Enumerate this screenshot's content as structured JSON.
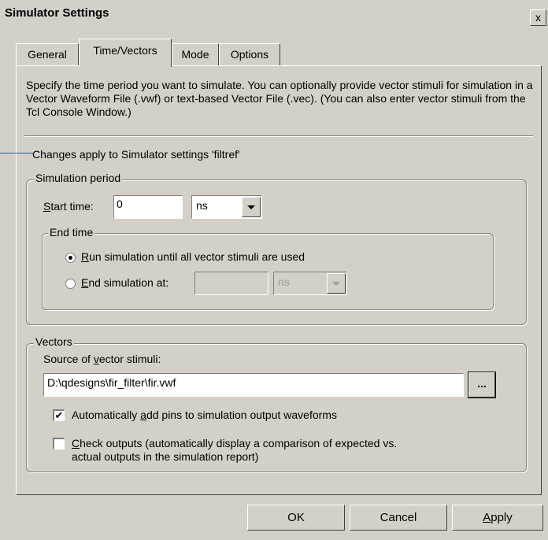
{
  "window": {
    "title": "Simulator Settings",
    "close_glyph": "x"
  },
  "tabs": [
    {
      "label": "General"
    },
    {
      "label": "Time/Vectors",
      "selected": true
    },
    {
      "label": "Mode"
    },
    {
      "label": "Options"
    }
  ],
  "description": "Specify the time period you want to simulate.  You can optionally provide vector stimuli for simulation in a Vector Waveform File (.vwf) or text-based Vector File (.vec).  (You can also enter vector stimuli from the Tcl Console Window.)",
  "changes_note": "Changes apply to Simulator settings 'filtref'",
  "simulation_period": {
    "legend": "Simulation period",
    "start_time_label_prefix": "S",
    "start_time_label_rest": "tart time:",
    "start_time_value": "0",
    "start_unit": "ns",
    "end_time": {
      "legend": "End time",
      "run_until_prefix": "R",
      "run_until_rest": "un simulation until all vector stimuli are used",
      "run_until_selected": true,
      "end_at_prefix": "E",
      "end_at_rest": "nd simulation at:",
      "end_at_value": "",
      "end_unit": "ns"
    }
  },
  "vectors": {
    "legend": "Vectors",
    "source_label_pre": "Source of ",
    "source_label_u": "v",
    "source_label_post": "ector stimuli:",
    "source_value": "D:\\qdesigns\\fir_filter\\fir.vwf",
    "browse_label": "...",
    "auto_add_pre": "Automatically ",
    "auto_add_u": "a",
    "auto_add_post": "dd pins to simulation output waveforms",
    "auto_add_checked": true,
    "check_outputs_u": "C",
    "check_outputs_line1": "heck outputs (automatically display a comparison of expected vs.",
    "check_outputs_line2": "actual outputs in the simulation report)",
    "check_outputs_checked": false
  },
  "buttons": {
    "ok": "OK",
    "cancel": "Cancel",
    "apply_u": "A",
    "apply_rest": "pply"
  }
}
